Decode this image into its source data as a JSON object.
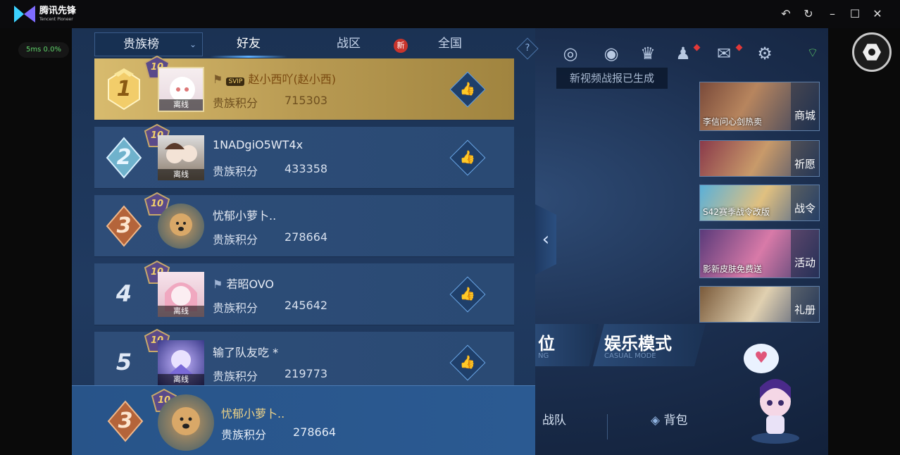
{
  "app": {
    "logo_text": "腾讯先锋",
    "logo_sub": "Tencent Pioneer",
    "ping": "5ms  0.0%"
  },
  "window_controls": [
    "back-icon",
    "refresh-icon",
    "minimize-icon",
    "maximize-icon",
    "close-icon"
  ],
  "tabs": {
    "selector": "贵族榜",
    "items": [
      {
        "label": "好友",
        "active": true
      },
      {
        "label": "战区",
        "active": false,
        "badge": "新"
      },
      {
        "label": "全国",
        "active": false
      }
    ],
    "help": "?"
  },
  "leaderboard": [
    {
      "rank": "1",
      "level": "10",
      "name": "赵小西吖(赵小西)",
      "points_label": "贵族积分",
      "points": "715303",
      "status": "离线",
      "likable": true,
      "vip": "SVIP"
    },
    {
      "rank": "2",
      "level": "10",
      "name": "1NADgiO5WT4x",
      "points_label": "贵族积分",
      "points": "433358",
      "status": "离线",
      "likable": true
    },
    {
      "rank": "3",
      "level": "10",
      "name": "忧郁小萝卜..",
      "points_label": "贵族积分",
      "points": "278664",
      "status": "",
      "likable": false
    },
    {
      "rank": "4",
      "level": "10",
      "name": "若昭OVO",
      "points_label": "贵族积分",
      "points": "245642",
      "status": "离线",
      "likable": true
    },
    {
      "rank": "5",
      "level": "10",
      "name": "输了队友吃 *",
      "points_label": "贵族积分",
      "points": "219773",
      "status": "离线",
      "likable": true
    }
  ],
  "my_entry": {
    "rank": "3",
    "level": "10",
    "name": "忧郁小萝卜..",
    "points_label": "贵族积分",
    "points": "278664"
  },
  "hud": {
    "toast": "新视频战报已生成",
    "promos": [
      {
        "caption": "李信问心剑热卖",
        "side": "商城"
      },
      {
        "caption": "",
        "side": "祈愿"
      },
      {
        "caption": "S42赛季战令改版",
        "side": "战令"
      },
      {
        "caption": "影新皮肤免费送",
        "side": "活动"
      },
      {
        "caption": "",
        "side": "礼册"
      }
    ],
    "mode_left": "位",
    "mode_left_sub": "NG",
    "mode_title": "娱乐模式",
    "mode_sub": "CASUAL MODE",
    "nav": [
      {
        "label": "战队"
      },
      {
        "label": "背包"
      }
    ]
  },
  "colors": {
    "gold_row": "#d8bb6e",
    "panel": "#1b3253",
    "accent": "#5fb0ff"
  }
}
